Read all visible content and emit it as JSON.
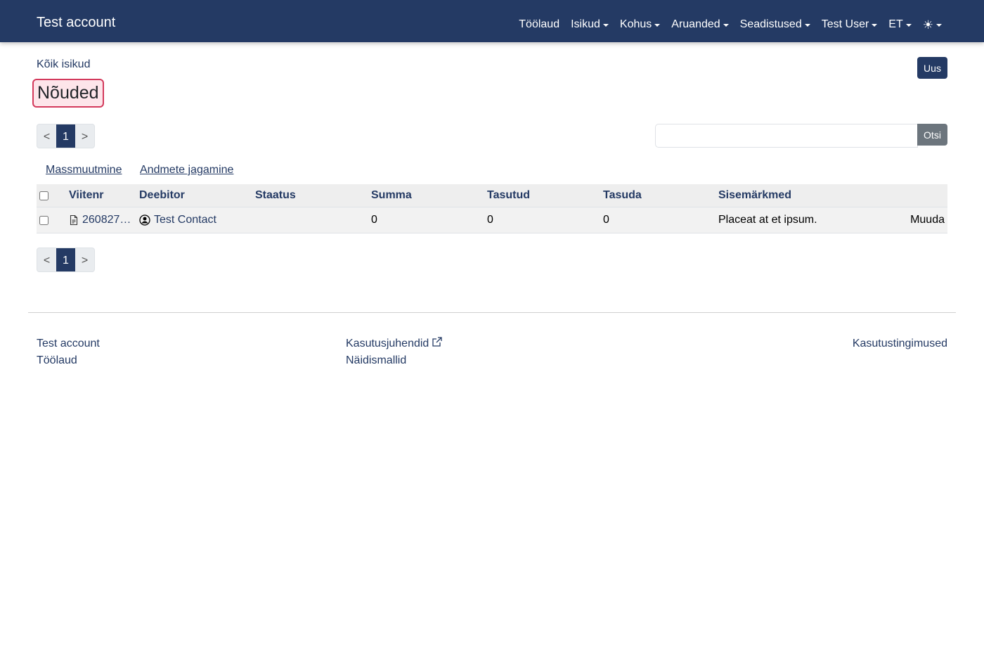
{
  "navbar": {
    "brand": "Test account",
    "items": [
      {
        "label": "Töölaud",
        "dropdown": false
      },
      {
        "label": "Isikud",
        "dropdown": true
      },
      {
        "label": "Kohus",
        "dropdown": true
      },
      {
        "label": "Aruanded",
        "dropdown": true
      },
      {
        "label": "Seadistused",
        "dropdown": true
      },
      {
        "label": "Test User",
        "dropdown": true
      },
      {
        "label": "ET",
        "dropdown": true
      }
    ],
    "theme_icon": "☀",
    "accent_color": "#243a64"
  },
  "breadcrumb": "Kõik isikud",
  "new_button": "Uus",
  "page_title": "Nõuded",
  "pagination": {
    "prev": "<",
    "current": "1",
    "next": ">"
  },
  "search": {
    "value": "",
    "placeholder": "",
    "button": "Otsi"
  },
  "actions": {
    "mass_edit": "Massmuutmine",
    "share": "Andmete jagamine"
  },
  "table": {
    "headers": {
      "ref": "Viitenr",
      "debtor": "Deebitor",
      "status": "Staatus",
      "sum": "Summa",
      "paid": "Tasutud",
      "due": "Tasuda",
      "notes": "Sisemärkmed"
    },
    "rows": [
      {
        "ref": "260827…",
        "debtor": "Test Contact",
        "status": "",
        "sum": "0",
        "paid": "0",
        "due": "0",
        "notes": "Placeat at et ipsum.",
        "edit": "Muuda"
      }
    ]
  },
  "footer": {
    "col1": [
      "Test account",
      "Töölaud"
    ],
    "col2": [
      "Kasutusjuhendid",
      "Näidismallid"
    ],
    "col3": [
      "Kasutustingimused"
    ]
  },
  "icons": {
    "ref_icon": "file-text-icon",
    "debtor_icon": "person-circle-icon",
    "external_icon": "external-link-icon"
  }
}
